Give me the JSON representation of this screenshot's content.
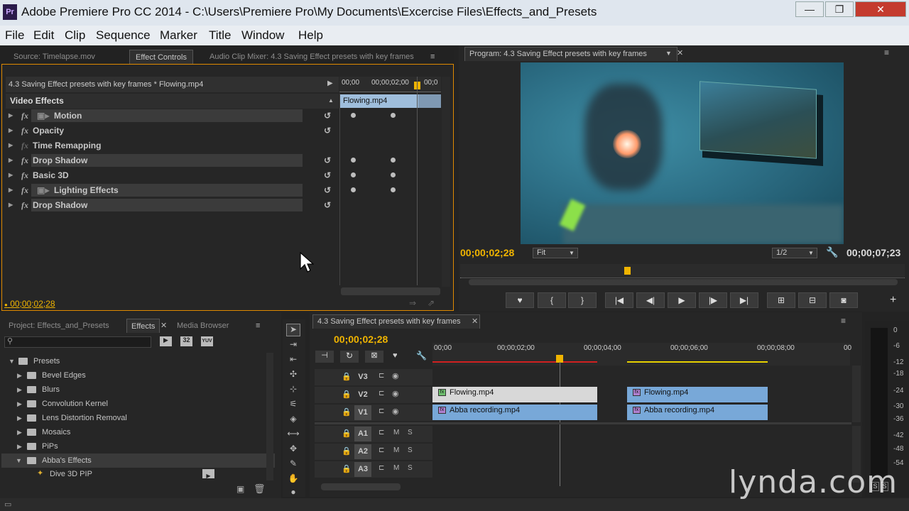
{
  "window": {
    "title": "Adobe Premiere Pro CC 2014 - C:\\Users\\Premiere Pro\\My Documents\\Excercise Files\\Effects_and_Presets",
    "logo": "Pr",
    "min": "—",
    "max": "❐",
    "close": "✕"
  },
  "menu": [
    "File",
    "Edit",
    "Clip",
    "Sequence",
    "Marker",
    "Title",
    "Window",
    "Help"
  ],
  "source_panel": {
    "tabs": [
      "Source: Timelapse.mov",
      "Effect Controls",
      "Audio Clip Mixer: 4.3 Saving Effect presets with key frames"
    ],
    "header": "4.3 Saving Effect presets with key frames * Flowing.mp4",
    "section": "Video Effects",
    "clip_label": "Flowing.mp4",
    "ruler": [
      "00;00",
      "00;00;02;00",
      "00;0"
    ],
    "effects": [
      {
        "name": "Motion",
        "icon": true
      },
      {
        "name": "Opacity"
      },
      {
        "name": "Time Remapping"
      },
      {
        "name": "Drop Shadow"
      },
      {
        "name": "Basic 3D"
      },
      {
        "name": "Lighting Effects",
        "icon": true
      },
      {
        "name": "Drop Shadow"
      }
    ],
    "timecode": "00;00;02;28"
  },
  "program": {
    "tab": "Program: 4.3 Saving Effect presets with key frames",
    "timecode": "00;00;02;28",
    "fit": "Fit",
    "res": "1/2",
    "duration": "00;00;07;23"
  },
  "effects_panel": {
    "tabs": [
      "Project: Effects_and_Presets",
      "Effects",
      "Media Browser"
    ],
    "tree": [
      {
        "label": "Presets",
        "level": 0,
        "open": true
      },
      {
        "label": "Bevel Edges",
        "level": 1
      },
      {
        "label": "Blurs",
        "level": 1
      },
      {
        "label": "Convolution Kernel",
        "level": 1
      },
      {
        "label": "Lens Distortion Removal",
        "level": 1
      },
      {
        "label": "Mosaics",
        "level": 1
      },
      {
        "label": "PiPs",
        "level": 1
      },
      {
        "label": "Abba's Effects",
        "level": 1,
        "open": true
      },
      {
        "label": "Dive 3D PIP",
        "level": 2
      }
    ],
    "badges": [
      "32",
      "YUV"
    ]
  },
  "timeline": {
    "tab": "4.3 Saving Effect presets with key frames",
    "timecode": "00;00;02;28",
    "ruler": [
      "00;00",
      "00;00;02;00",
      "00;00;04;00",
      "00;00;06;00",
      "00;00;08;00",
      "00"
    ],
    "tracks": [
      "V3",
      "V2",
      "V1",
      "A1",
      "A2",
      "A3"
    ],
    "clips": [
      {
        "track": "V2",
        "label": "Flowing.mp4"
      },
      {
        "track": "V1",
        "label": "Abba recording.mp4"
      },
      {
        "track": "V2",
        "label": "Flowing.mp4"
      },
      {
        "track": "V1",
        "label": "Abba recording.mp4"
      }
    ],
    "ms": [
      "M",
      "S"
    ]
  },
  "meter": {
    "labels": [
      "0",
      "-6",
      "-12",
      "-18",
      "-24",
      "-30",
      "-36",
      "-42",
      "-48",
      "-54"
    ],
    "solo": [
      "S",
      "S"
    ]
  },
  "watermark": "lynda.com",
  "colors": {
    "accent": "#f0b400",
    "clip_video": "#78a8d8",
    "clip_light": "#d8d8d8"
  }
}
